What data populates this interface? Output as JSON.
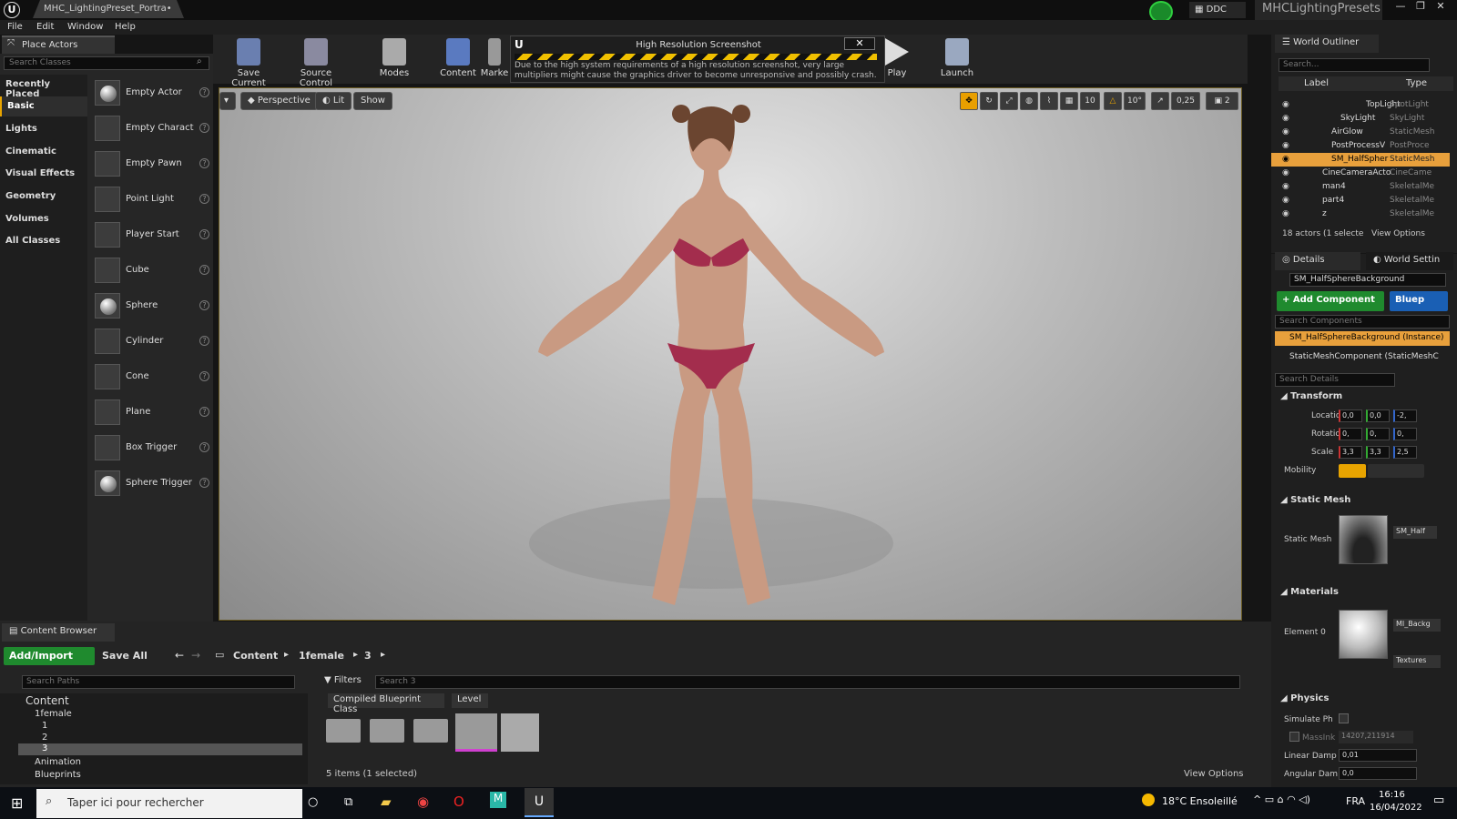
{
  "titlebar": {
    "tab": "MHC_LightingPreset_Portra•",
    "ddc": "DDC",
    "project": "MHCLightingPresets",
    "win": [
      "—",
      "❐",
      "✕"
    ]
  },
  "menu": [
    "File",
    "Edit",
    "Window",
    "Help"
  ],
  "place_actors": {
    "tab": "Place Actors",
    "search_placeholder": "Search Classes",
    "categories": [
      "Recently Placed",
      "Basic",
      "Lights",
      "Cinematic",
      "Visual Effects",
      "Geometry",
      "Volumes",
      "All Classes"
    ],
    "selected_category": "Basic",
    "actors": [
      "Empty Actor",
      "Empty Charact",
      "Empty Pawn",
      "Point Light",
      "Player Start",
      "Cube",
      "Sphere",
      "Cylinder",
      "Cone",
      "Plane",
      "Box Trigger",
      "Sphere Trigger"
    ]
  },
  "toolbar": {
    "save_current": "Save Current",
    "source_control": "Source Control",
    "modes": "Modes",
    "content": "Content",
    "market": "Marke",
    "play": "Play",
    "launch": "Launch"
  },
  "notification": {
    "title": "High Resolution Screenshot",
    "body": "Due to the high system requirements of a high resolution screenshot, very large multipliers might cause the graphics driver to become unresponsive and possibly crash.",
    "close": "✕"
  },
  "viewport": {
    "perspective": "Perspective",
    "lit": "Lit",
    "show": "Show",
    "grid": "10",
    "angle": "10°",
    "scale": "0,25",
    "cam": "2"
  },
  "outliner": {
    "tab": "World Outliner",
    "search_placeholder": "Search...",
    "col_label": "Label",
    "col_type": "Type",
    "rows": [
      {
        "name": "TopLight",
        "type": "SpotLight"
      },
      {
        "name": "SkyLight",
        "type": "SkyLight"
      },
      {
        "name": "AirGlow",
        "type": "StaticMesh"
      },
      {
        "name": "PostProcessV",
        "type": "PostProce"
      },
      {
        "name": "SM_HalfSpher",
        "type": "StaticMesh"
      },
      {
        "name": "CineCameraActo",
        "type": "CineCame"
      },
      {
        "name": "man4",
        "type": "SkeletalMe"
      },
      {
        "name": "part4",
        "type": "SkeletalMe"
      },
      {
        "name": "z",
        "type": "SkeletalMe"
      }
    ],
    "footer": "18 actors (1 selecte",
    "view_options": "View Options"
  },
  "details": {
    "tab": "Details",
    "tab2": "World Settin",
    "actor_name": "SM_HalfSphereBackground",
    "add_component": "+ Add Component",
    "blueprint": "Bluep",
    "search_components": "Search Components",
    "instance": "SM_HalfSphereBackground (Instance)",
    "component": "StaticMeshComponent (StaticMeshC",
    "search_details": "Search Details",
    "transform": "Transform",
    "location": "Location",
    "rotation": "Rotation",
    "scale": "Scale",
    "mobility": "Mobility",
    "loc_vals": [
      "0,0",
      "0,0",
      "-2,"
    ],
    "rot_vals": [
      "0,",
      "0,",
      "0,"
    ],
    "scale_vals": [
      "3,3",
      "3,3",
      "2,5"
    ],
    "static_mesh_section": "Static Mesh",
    "static_mesh": "Static Mesh",
    "mesh_name": "SM_Half",
    "materials_section": "Materials",
    "element0": "Element 0",
    "mat_name": "MI_Backg",
    "textures": "Textures",
    "physics_section": "Physics",
    "simulate": "Simulate Ph",
    "mass": "MassInk",
    "mass_val": "14207,211914",
    "linear_damp": "Linear Damp",
    "linear_val": "0,01",
    "angular_damp": "Angular Dam",
    "angular_val": "0,0"
  },
  "content_browser": {
    "tab": "Content Browser",
    "add_import": "Add/Import",
    "save_all": "Save All",
    "path": [
      "Content",
      "1female",
      "3"
    ],
    "search_paths": "Search Paths",
    "filters": "Filters",
    "search_placeholder": "Search 3",
    "tree": [
      "Content",
      "1female",
      "1",
      "2",
      "3",
      "Animation",
      "Blueprints"
    ],
    "chips": [
      "Compiled Blueprint Class",
      "Level"
    ],
    "status": "5 items (1 selected)",
    "view_options": "View Options"
  },
  "taskbar": {
    "search": "Taper ici pour rechercher",
    "weather": "18°C Ensoleillé",
    "lang": "FRA",
    "time": "16:16",
    "date": "16/04/2022"
  }
}
